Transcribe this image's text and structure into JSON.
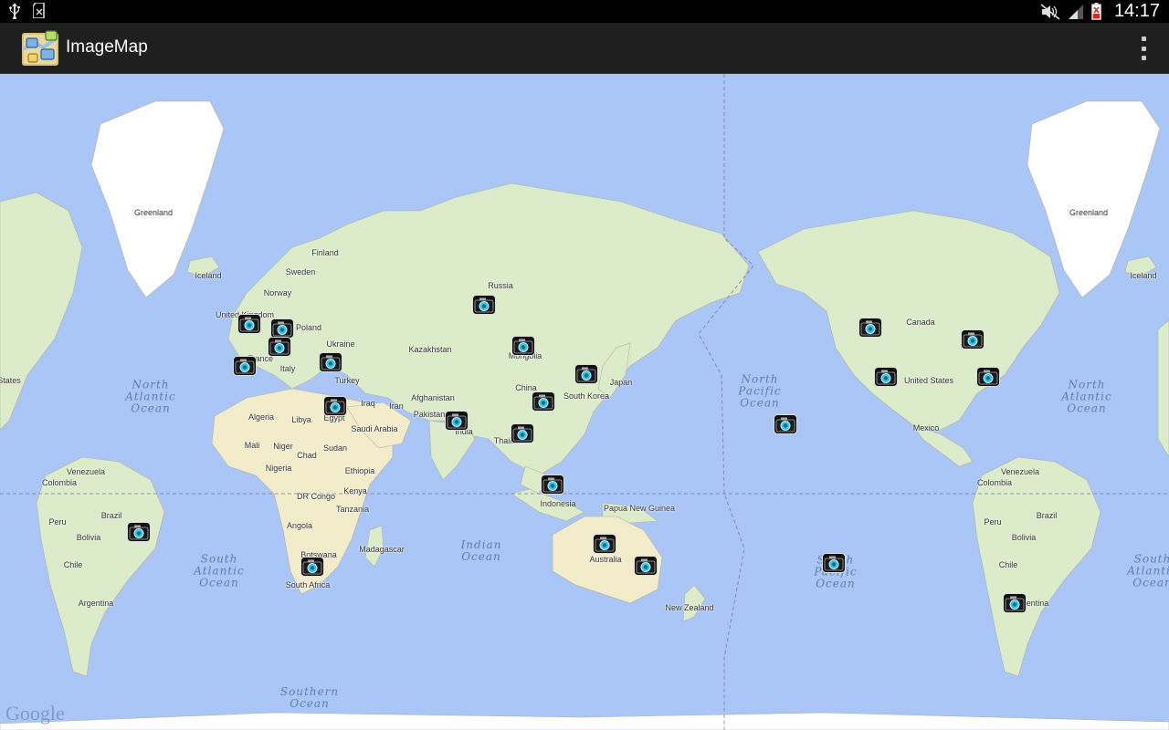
{
  "status_bar": {
    "time": "14:17",
    "left_icons": [
      "usb-icon",
      "sd-card-icon"
    ],
    "right_icons": [
      "mute-icon",
      "signal-icon",
      "battery-low-icon"
    ]
  },
  "action_bar": {
    "app_title": "ImageMap",
    "app_icon": "image-map-app-icon",
    "overflow_icon": "overflow-menu-icon"
  },
  "map": {
    "attribution": "Google",
    "country_labels": [
      {
        "text": "Greenland"
      },
      {
        "text": "Greenland"
      },
      {
        "text": "Iceland"
      },
      {
        "text": "Iceland"
      },
      {
        "text": "Finland"
      },
      {
        "text": "Sweden"
      },
      {
        "text": "Norway"
      },
      {
        "text": "United Kingdom"
      },
      {
        "text": "Poland"
      },
      {
        "text": "Ukraine"
      },
      {
        "text": "France"
      },
      {
        "text": "Italy"
      },
      {
        "text": "Turkey"
      },
      {
        "text": "Russia"
      },
      {
        "text": "Kazakhstan"
      },
      {
        "text": "Mongolia"
      },
      {
        "text": "China"
      },
      {
        "text": "Japan"
      },
      {
        "text": "South Korea"
      },
      {
        "text": "Afghanistan"
      },
      {
        "text": "Pakistan"
      },
      {
        "text": "India"
      },
      {
        "text": "Thailand"
      },
      {
        "text": "Iraq"
      },
      {
        "text": "Iran"
      },
      {
        "text": "Saudi Arabia"
      },
      {
        "text": "Egypt"
      },
      {
        "text": "Libya"
      },
      {
        "text": "Algeria"
      },
      {
        "text": "Mali"
      },
      {
        "text": "Niger"
      },
      {
        "text": "Chad"
      },
      {
        "text": "Sudan"
      },
      {
        "text": "Nigeria"
      },
      {
        "text": "Ethiopia"
      },
      {
        "text": "DR Congo"
      },
      {
        "text": "Kenya"
      },
      {
        "text": "Tanzania"
      },
      {
        "text": "Angola"
      },
      {
        "text": "Botswana"
      },
      {
        "text": "Madagascar"
      },
      {
        "text": "South Africa"
      },
      {
        "text": "Indonesia"
      },
      {
        "text": "Papua New Guinea"
      },
      {
        "text": "Australia"
      },
      {
        "text": "New Zealand"
      },
      {
        "text": "Canada"
      },
      {
        "text": "United States"
      },
      {
        "text": "Mexico"
      },
      {
        "text": "Venezuela"
      },
      {
        "text": "Colombia"
      },
      {
        "text": "Peru"
      },
      {
        "text": "Brazil"
      },
      {
        "text": "Bolivia"
      },
      {
        "text": "Chile"
      },
      {
        "text": "Argentina"
      },
      {
        "text": "Venezuela"
      },
      {
        "text": "Colombia"
      },
      {
        "text": "Peru"
      },
      {
        "text": "Brazil"
      },
      {
        "text": "Bolivia"
      },
      {
        "text": "Chile"
      },
      {
        "text": "Argentina"
      },
      {
        "text": "States"
      }
    ],
    "ocean_labels": [
      {
        "text": "North\nAtlantic\nOcean"
      },
      {
        "text": "South\nAtlantic\nOcean"
      },
      {
        "text": "Indian\nOcean"
      },
      {
        "text": "Southern\nOcean"
      },
      {
        "text": "North\nPacific\nOcean"
      },
      {
        "text": "South\nPacific\nOcean"
      },
      {
        "text": "North\nAtlantic\nOcean"
      },
      {
        "text": "South\nAtlantic\nOcean"
      }
    ],
    "photo_marker_count": 28,
    "marker_icon": "camera-icon"
  }
}
